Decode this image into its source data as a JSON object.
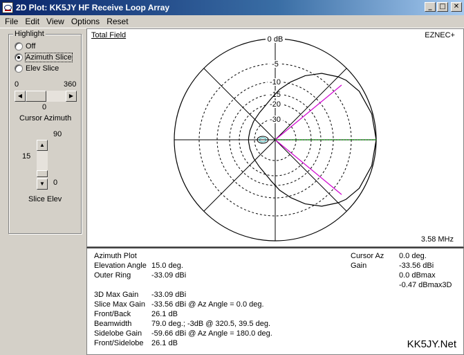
{
  "window": {
    "title": "2D Plot: KK5JY HF Receive Loop Array"
  },
  "menu": {
    "file": "File",
    "edit": "Edit",
    "view": "View",
    "options": "Options",
    "reset": "Reset"
  },
  "highlight": {
    "title": "Highlight",
    "options": [
      "Off",
      "Azimuth Slice",
      "Elev Slice"
    ],
    "selected": "Azimuth Slice"
  },
  "azimuth_slider": {
    "min": "0",
    "max": "360",
    "value": "0",
    "caption": "Cursor Azimuth"
  },
  "elev_slider": {
    "max": "90",
    "min": "0",
    "value": "15",
    "caption": "Slice Elev"
  },
  "plot": {
    "field_label": "Total Field",
    "source_label": "EZNEC+",
    "frequency": "3.58 MHz",
    "ring_labels": [
      "0 dB",
      "-5",
      "-10",
      "-15",
      "-20",
      "-30"
    ],
    "cursor_color": "#00a000",
    "lobe_color": "#d000d0"
  },
  "chart_data": {
    "type": "polar",
    "plot_kind": "Azimuth Plot",
    "rings_db": [
      0,
      -5,
      -10,
      -15,
      -20,
      -30
    ],
    "pattern": [
      {
        "az": 0,
        "db": 0
      },
      {
        "az": 15,
        "db": -0.2
      },
      {
        "az": 30,
        "db": -0.8
      },
      {
        "az": 40,
        "db": -1.7
      },
      {
        "az": 45,
        "db": -2.4
      },
      {
        "az": 55,
        "db": -4.0
      },
      {
        "az": 65,
        "db": -6.5
      },
      {
        "az": 75,
        "db": -9.5
      },
      {
        "az": 85,
        "db": -13
      },
      {
        "az": 95,
        "db": -17
      },
      {
        "az": 105,
        "db": -20
      },
      {
        "az": 120,
        "db": -23
      },
      {
        "az": 140,
        "db": -25
      },
      {
        "az": 160,
        "db": -26
      },
      {
        "az": 175,
        "db": -26.1
      },
      {
        "az": 180,
        "db": -26.1
      }
    ],
    "cursor_az": 0,
    "beam_edges_az": [
      320.5,
      39.5
    ]
  },
  "info": {
    "plot_type": "Azimuth Plot",
    "rows": [
      {
        "label": "Elevation Angle",
        "value": "15.0 deg."
      },
      {
        "label": "Outer Ring",
        "value": "-33.09 dBi"
      },
      {
        "label": "3D Max Gain",
        "value": "-33.09 dBi"
      },
      {
        "label": "Slice Max Gain",
        "value": "-33.56 dBi @ Az Angle = 0.0 deg."
      },
      {
        "label": "Front/Back",
        "value": "26.1 dB"
      },
      {
        "label": "Beamwidth",
        "value": "79.0 deg.; -3dB @ 320.5, 39.5 deg."
      },
      {
        "label": "Sidelobe Gain",
        "value": "-59.66 dBi @ Az Angle = 180.0 deg."
      },
      {
        "label": "Front/Sidelobe",
        "value": "26.1 dB"
      }
    ],
    "cursor": {
      "az_label": "Cursor Az",
      "az_value": "0.0 deg.",
      "gain_label": "Gain",
      "gain_value": "-33.56 dBi",
      "dbmax": "0.0 dBmax",
      "dbmax3d": "-0.47 dBmax3D"
    },
    "brand": "KK5JY.Net"
  }
}
